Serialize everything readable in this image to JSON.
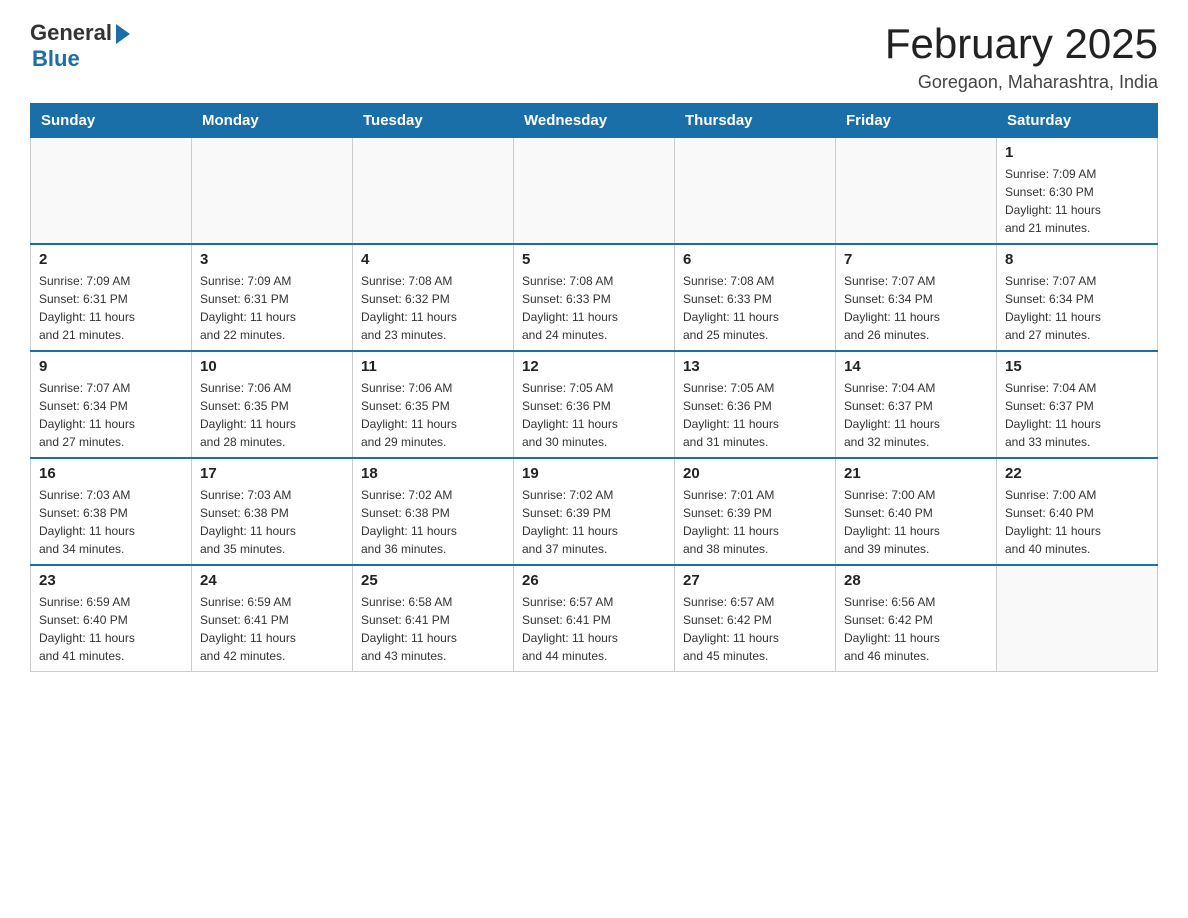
{
  "logo": {
    "general": "General",
    "blue": "Blue"
  },
  "title": "February 2025",
  "subtitle": "Goregaon, Maharashtra, India",
  "weekdays": [
    "Sunday",
    "Monday",
    "Tuesday",
    "Wednesday",
    "Thursday",
    "Friday",
    "Saturday"
  ],
  "weeks": [
    [
      {
        "day": "",
        "info": ""
      },
      {
        "day": "",
        "info": ""
      },
      {
        "day": "",
        "info": ""
      },
      {
        "day": "",
        "info": ""
      },
      {
        "day": "",
        "info": ""
      },
      {
        "day": "",
        "info": ""
      },
      {
        "day": "1",
        "info": "Sunrise: 7:09 AM\nSunset: 6:30 PM\nDaylight: 11 hours\nand 21 minutes."
      }
    ],
    [
      {
        "day": "2",
        "info": "Sunrise: 7:09 AM\nSunset: 6:31 PM\nDaylight: 11 hours\nand 21 minutes."
      },
      {
        "day": "3",
        "info": "Sunrise: 7:09 AM\nSunset: 6:31 PM\nDaylight: 11 hours\nand 22 minutes."
      },
      {
        "day": "4",
        "info": "Sunrise: 7:08 AM\nSunset: 6:32 PM\nDaylight: 11 hours\nand 23 minutes."
      },
      {
        "day": "5",
        "info": "Sunrise: 7:08 AM\nSunset: 6:33 PM\nDaylight: 11 hours\nand 24 minutes."
      },
      {
        "day": "6",
        "info": "Sunrise: 7:08 AM\nSunset: 6:33 PM\nDaylight: 11 hours\nand 25 minutes."
      },
      {
        "day": "7",
        "info": "Sunrise: 7:07 AM\nSunset: 6:34 PM\nDaylight: 11 hours\nand 26 minutes."
      },
      {
        "day": "8",
        "info": "Sunrise: 7:07 AM\nSunset: 6:34 PM\nDaylight: 11 hours\nand 27 minutes."
      }
    ],
    [
      {
        "day": "9",
        "info": "Sunrise: 7:07 AM\nSunset: 6:34 PM\nDaylight: 11 hours\nand 27 minutes."
      },
      {
        "day": "10",
        "info": "Sunrise: 7:06 AM\nSunset: 6:35 PM\nDaylight: 11 hours\nand 28 minutes."
      },
      {
        "day": "11",
        "info": "Sunrise: 7:06 AM\nSunset: 6:35 PM\nDaylight: 11 hours\nand 29 minutes."
      },
      {
        "day": "12",
        "info": "Sunrise: 7:05 AM\nSunset: 6:36 PM\nDaylight: 11 hours\nand 30 minutes."
      },
      {
        "day": "13",
        "info": "Sunrise: 7:05 AM\nSunset: 6:36 PM\nDaylight: 11 hours\nand 31 minutes."
      },
      {
        "day": "14",
        "info": "Sunrise: 7:04 AM\nSunset: 6:37 PM\nDaylight: 11 hours\nand 32 minutes."
      },
      {
        "day": "15",
        "info": "Sunrise: 7:04 AM\nSunset: 6:37 PM\nDaylight: 11 hours\nand 33 minutes."
      }
    ],
    [
      {
        "day": "16",
        "info": "Sunrise: 7:03 AM\nSunset: 6:38 PM\nDaylight: 11 hours\nand 34 minutes."
      },
      {
        "day": "17",
        "info": "Sunrise: 7:03 AM\nSunset: 6:38 PM\nDaylight: 11 hours\nand 35 minutes."
      },
      {
        "day": "18",
        "info": "Sunrise: 7:02 AM\nSunset: 6:38 PM\nDaylight: 11 hours\nand 36 minutes."
      },
      {
        "day": "19",
        "info": "Sunrise: 7:02 AM\nSunset: 6:39 PM\nDaylight: 11 hours\nand 37 minutes."
      },
      {
        "day": "20",
        "info": "Sunrise: 7:01 AM\nSunset: 6:39 PM\nDaylight: 11 hours\nand 38 minutes."
      },
      {
        "day": "21",
        "info": "Sunrise: 7:00 AM\nSunset: 6:40 PM\nDaylight: 11 hours\nand 39 minutes."
      },
      {
        "day": "22",
        "info": "Sunrise: 7:00 AM\nSunset: 6:40 PM\nDaylight: 11 hours\nand 40 minutes."
      }
    ],
    [
      {
        "day": "23",
        "info": "Sunrise: 6:59 AM\nSunset: 6:40 PM\nDaylight: 11 hours\nand 41 minutes."
      },
      {
        "day": "24",
        "info": "Sunrise: 6:59 AM\nSunset: 6:41 PM\nDaylight: 11 hours\nand 42 minutes."
      },
      {
        "day": "25",
        "info": "Sunrise: 6:58 AM\nSunset: 6:41 PM\nDaylight: 11 hours\nand 43 minutes."
      },
      {
        "day": "26",
        "info": "Sunrise: 6:57 AM\nSunset: 6:41 PM\nDaylight: 11 hours\nand 44 minutes."
      },
      {
        "day": "27",
        "info": "Sunrise: 6:57 AM\nSunset: 6:42 PM\nDaylight: 11 hours\nand 45 minutes."
      },
      {
        "day": "28",
        "info": "Sunrise: 6:56 AM\nSunset: 6:42 PM\nDaylight: 11 hours\nand 46 minutes."
      },
      {
        "day": "",
        "info": ""
      }
    ]
  ]
}
